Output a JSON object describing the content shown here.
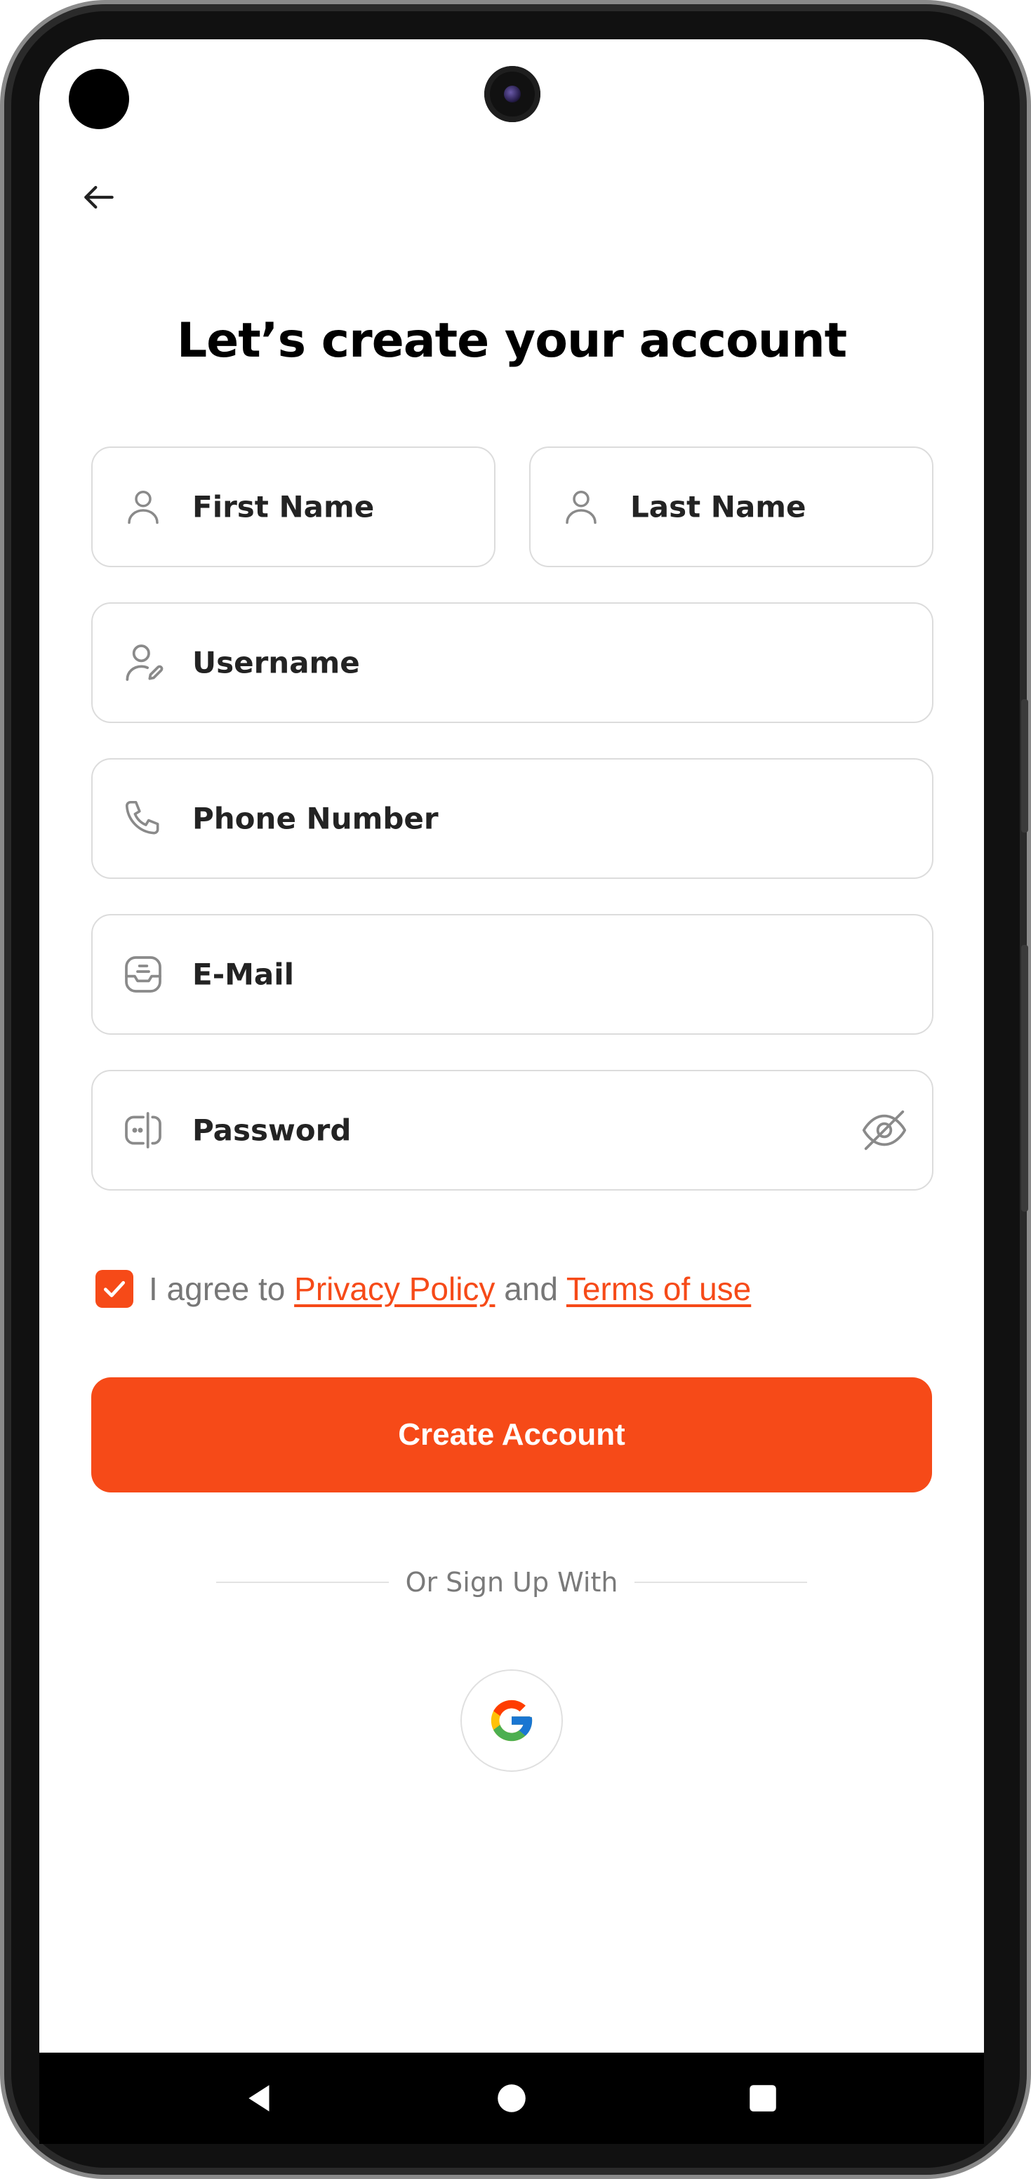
{
  "header": {
    "back_icon": "arrow-left-icon",
    "title": "Let’s create your account"
  },
  "form": {
    "first_name": {
      "label": "First Name",
      "icon": "user-icon"
    },
    "last_name": {
      "label": "Last Name",
      "icon": "user-icon"
    },
    "username": {
      "label": "Username",
      "icon": "user-edit-icon"
    },
    "phone": {
      "label": "Phone Number",
      "icon": "phone-icon"
    },
    "email": {
      "label": "E-Mail",
      "icon": "inbox-icon"
    },
    "password": {
      "label": "Password",
      "icon": "password-icon",
      "toggle_icon": "eye-slash-icon"
    }
  },
  "agreement": {
    "checked": true,
    "prefix": "I agree to ",
    "privacy_link": "Privacy Policy",
    "middle": " and ",
    "terms_link": "Terms of use"
  },
  "actions": {
    "create_account": "Create Account",
    "divider_text": "Or Sign Up With",
    "google_icon": "google-icon"
  },
  "colors": {
    "accent": "#f64a18",
    "text_dark": "#232323",
    "text_muted": "#777777",
    "border": "#dcdcdc"
  },
  "system_nav": {
    "back": "nav-back-icon",
    "home": "nav-home-icon",
    "recents": "nav-recents-icon"
  }
}
